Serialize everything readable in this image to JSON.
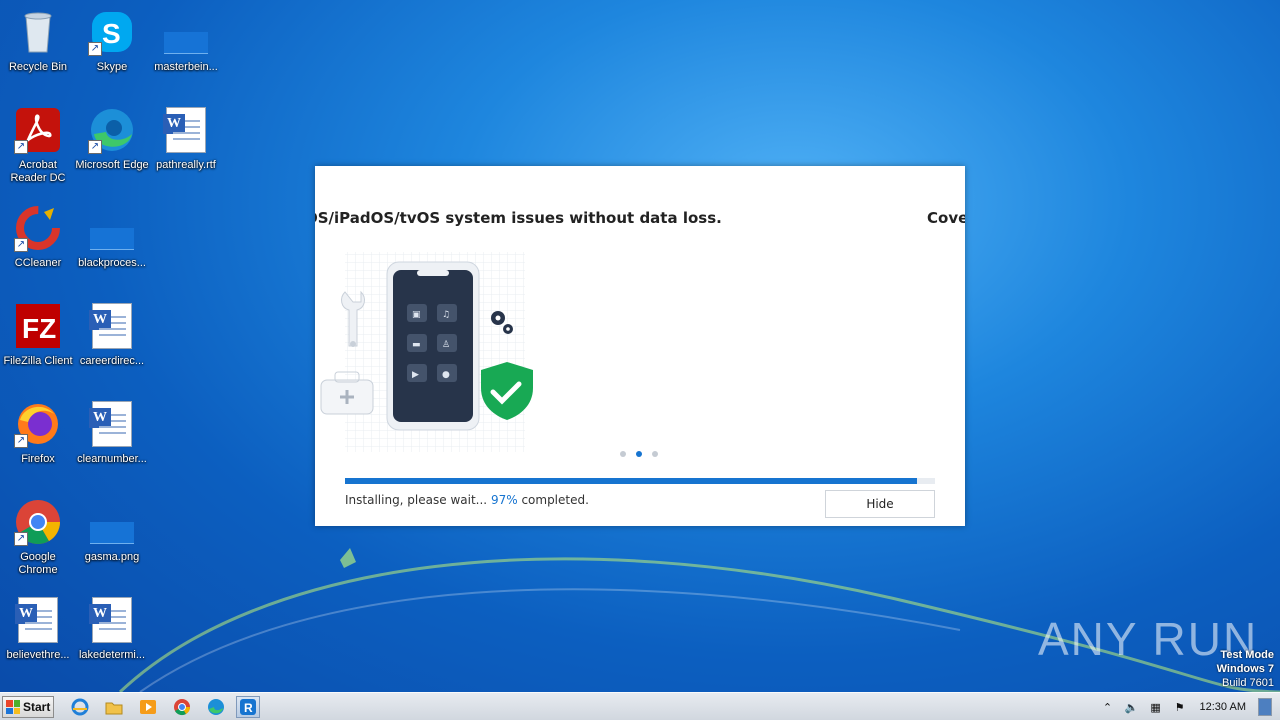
{
  "desktop": {
    "icons": [
      {
        "label": "Recycle Bin",
        "icon": "recycle-bin-icon"
      },
      {
        "label": "Skype",
        "icon": "skype-icon"
      },
      {
        "label": "masterbein...",
        "icon": "file-icon"
      },
      {
        "label": "Acrobat Reader DC",
        "icon": "acrobat-icon"
      },
      {
        "label": "Microsoft Edge",
        "icon": "edge-icon"
      },
      {
        "label": "pathreally.rtf",
        "icon": "word-document-icon"
      },
      {
        "label": "CCleaner",
        "icon": "ccleaner-icon"
      },
      {
        "label": "blackproces...",
        "icon": "file-icon"
      },
      {
        "label": "FileZilla Client",
        "icon": "filezilla-icon"
      },
      {
        "label": "careerdirec...",
        "icon": "word-document-icon"
      },
      {
        "label": "Firefox",
        "icon": "firefox-icon"
      },
      {
        "label": "clearnumber...",
        "icon": "word-document-icon"
      },
      {
        "label": "Google Chrome",
        "icon": "chrome-icon"
      },
      {
        "label": "gasma.png",
        "icon": "file-icon"
      },
      {
        "label": "believethre...",
        "icon": "word-document-icon"
      },
      {
        "label": "lakedetermi...",
        "icon": "word-document-icon"
      }
    ]
  },
  "installer": {
    "headline": "OS/iPadOS/tvOS system issues without data loss.",
    "headline_next": "Cove",
    "status_prefix": "Installing, please wait...",
    "progress_percent_label": "97%",
    "status_suffix": "completed.",
    "progress_fraction": 0.97,
    "hide_label": "Hide",
    "carousel_active_index": 1,
    "accent_color": "#1674d0"
  },
  "watermark": {
    "text": "ANY RUN"
  },
  "test_mode": {
    "line1": "Test Mode",
    "line2": "Windows 7",
    "line3": "Build 7601"
  },
  "taskbar": {
    "start_label": "Start",
    "pinned": [
      "internet-explorer-icon",
      "explorer-icon",
      "media-player-icon",
      "chrome-icon",
      "edge-icon",
      "installer-app-icon"
    ],
    "clock": "12:30 AM"
  }
}
